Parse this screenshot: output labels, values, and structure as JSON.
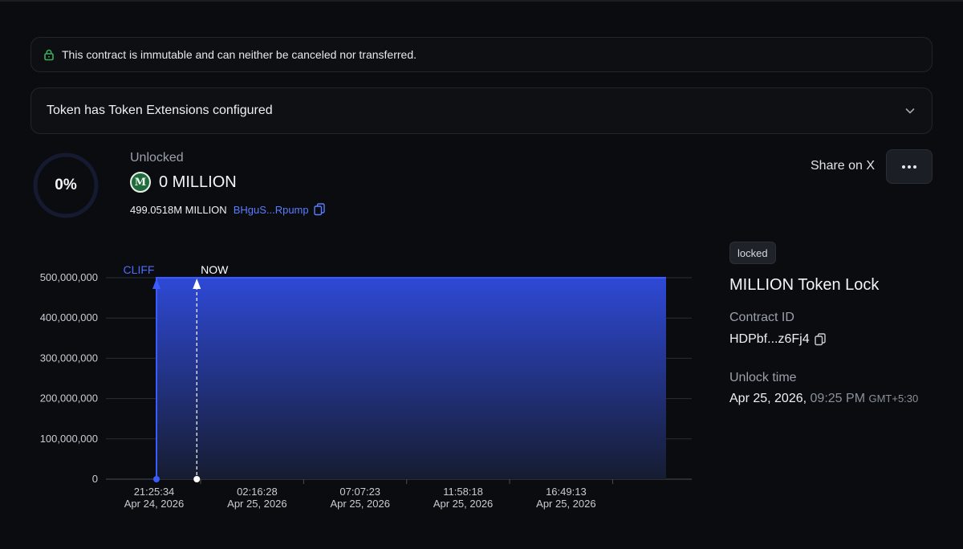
{
  "banner": {
    "text": "This contract is immutable and can neither be canceled nor transferred.",
    "icon": "lock-icon"
  },
  "accordion": {
    "title": "Token has Token Extensions configured",
    "icon": "chevron-down-icon"
  },
  "progress": {
    "percent_label": "0%",
    "percent": 0
  },
  "summary": {
    "unlocked_label": "Unlocked",
    "token_logo_letter": "M",
    "amount": "0 MILLION",
    "supply": "499.0518M MILLION",
    "address_short": "BHguS...Rpump"
  },
  "actions": {
    "share_label": "Share on X",
    "more_icon": "more-horizontal-icon"
  },
  "details": {
    "status_badge": "locked",
    "title": "MILLION Token Lock",
    "contract_id_label": "Contract ID",
    "contract_id": "HDPbf...z6Fj4",
    "unlock_time_label": "Unlock time",
    "unlock_date": "Apr 25, 2026,",
    "unlock_clock": "09:25 PM",
    "unlock_tz": "GMT+5:30"
  },
  "colors": {
    "accent": "#3a5cff",
    "background": "#0b0c0f",
    "link": "#5b7cff",
    "banner_lock": "#3fae5c"
  },
  "chart_data": {
    "type": "area",
    "y_ticks": [
      "500,000,000",
      "400,000,000",
      "300,000,000",
      "200,000,000",
      "100,000,000",
      "0"
    ],
    "y_tick_values": [
      500000000,
      400000000,
      300000000,
      200000000,
      100000000,
      0
    ],
    "ylim": [
      0,
      500000000
    ],
    "x_ticks": [
      {
        "time": "21:25:34",
        "date": "Apr 24, 2026",
        "frac": 0.0
      },
      {
        "time": "02:16:28",
        "date": "Apr 25, 2026",
        "frac": 0.2022
      },
      {
        "time": "07:07:23",
        "date": "Apr 25, 2026",
        "frac": 0.4043
      },
      {
        "time": "11:58:18",
        "date": "Apr 25, 2026",
        "frac": 0.6064
      },
      {
        "time": "16:49:13",
        "date": "Apr 25, 2026",
        "frac": 0.8085
      }
    ],
    "series": [
      {
        "x_frac": [
          0,
          0,
          1
        ],
        "values": [
          0,
          500000000,
          500000000
        ]
      }
    ],
    "markers": [
      {
        "label": "CLIFF",
        "frac": 0.0
      },
      {
        "label": "NOW",
        "frac": 0.0791
      }
    ],
    "grid": true
  }
}
